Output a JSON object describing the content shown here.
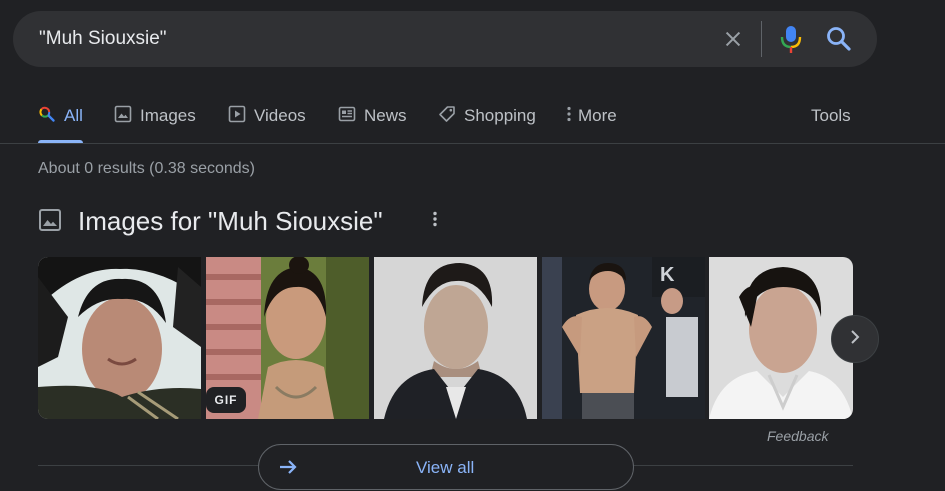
{
  "search": {
    "query": "\"Muh Siouxsie\"",
    "clear_icon": "close-icon",
    "voice_icon": "mic-icon",
    "search_icon": "search-icon"
  },
  "tabs": [
    {
      "label": "All",
      "icon": "search-icon",
      "active": true
    },
    {
      "label": "Images",
      "icon": "image-icon"
    },
    {
      "label": "Videos",
      "icon": "play-icon"
    },
    {
      "label": "News",
      "icon": "news-icon"
    },
    {
      "label": "Shopping",
      "icon": "tag-icon"
    },
    {
      "label": "More",
      "icon": "kebab-icon"
    }
  ],
  "tools_label": "Tools",
  "stats": "About 0 results (0.38 seconds)",
  "images_section": {
    "title": "Images for \"Muh Siouxsie\"",
    "gif_badge": "GIF",
    "feedback": "Feedback",
    "view_all": "View all"
  },
  "colors": {
    "background": "#202124",
    "search_bg": "#303134",
    "accent": "#8ab4f8",
    "text": "#bdc1c6",
    "muted": "#9aa0a6"
  }
}
